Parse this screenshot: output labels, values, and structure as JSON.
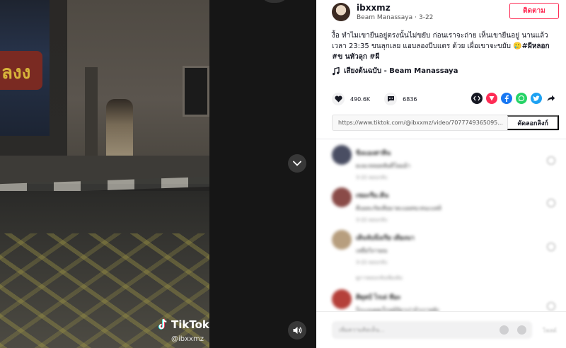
{
  "video": {
    "watermark_brand": "TikTok",
    "watermark_handle": "@ibxxmz",
    "sign_text": "ลงง"
  },
  "author": {
    "username": "ibxxmz",
    "display_name": "Beam Manassaya",
    "separator": "·",
    "date": "3-22",
    "follow_label": "ติดตาม"
  },
  "caption": {
    "text": "งื้อ ทำไมเขายืนอยู่ตรงนั้นไม่ขยับ ก่อนเราจะถ่าย เห็นเขายืนอยู่ นานแล้ว เวลา 23:35 ขนลุกเลย แอบลองบีบแตร ด้วย เผื่อเขาจะขยับ 🥲",
    "tags": [
      "#ผีหลอก",
      "#ข นหัวลุก",
      "#ผี"
    ]
  },
  "music": {
    "title": "เสียงต้นฉบับ - Beam Manassaya"
  },
  "stats": {
    "likes": "490.6K",
    "comments": "6836"
  },
  "share": {
    "url": "https://www.tiktok.com/@ibxxmz/video/7077749365095...",
    "copy_label": "คัดลอกลิงก์",
    "buttons": [
      "embed-icon",
      "tiktok-share-icon",
      "facebook-icon",
      "whatsapp-icon",
      "twitter-icon",
      "forward-icon"
    ],
    "colors": {
      "embed": "#161823",
      "tiktok": "#fe2c55",
      "facebook": "#1877f2",
      "whatsapp": "#25d366",
      "twitter": "#1da1f2"
    }
  },
  "comments_panel": {
    "items": [
      {
        "name": "ขิงเเองสาหิน",
        "text": "ผะผะหลอตลัษดีโผมอ้า",
        "meta": "3-22 ตอบกลับ",
        "avatar_color": "#4a4e63"
      },
      {
        "name": "เขมะรีม.ดีน",
        "text": "ดีแผละกัดเคียมาตะแผลขะหนะแสล้",
        "meta": "3-22 ตอบกลับ",
        "avatar_color": "#8a4b48"
      },
      {
        "name": "เดินจับนึงเรีย เดียงนา",
        "text": "เหยือวิภาษณ",
        "meta": "3-22 ตอบกลับ",
        "reply_hint": "ดูการตอบกลับเพิ่มเติม",
        "avatar_color": "#b79e7e"
      },
      {
        "name": "ศิตุสป์ ไรเด่ ทือะ",
        "text": "ก็กะเถเดคเร็กหย์ปัยาเร่าถ้าเราหลัง",
        "avatar_color": "#b5403a"
      }
    ]
  },
  "footer": {
    "placeholder": "เพิ่มความคิดเห็น...",
    "post_label": "โพสต์"
  },
  "accent": "#fe2c55"
}
